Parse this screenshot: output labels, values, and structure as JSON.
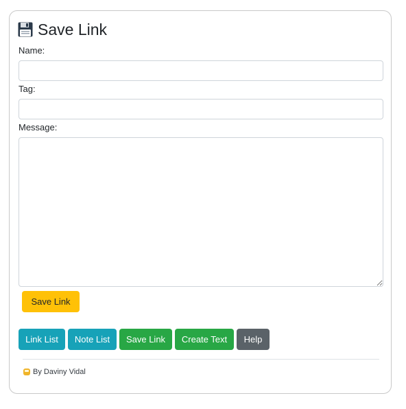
{
  "header": {
    "title": "Save Link",
    "icon": "floppy-disk-icon"
  },
  "form": {
    "name_label": "Name:",
    "name_value": "",
    "tag_label": "Tag:",
    "tag_value": "",
    "message_label": "Message:",
    "message_value": "",
    "submit_label": "Save Link"
  },
  "nav": {
    "link_list": "Link List",
    "note_list": "Note List",
    "save_link": "Save Link",
    "create_text": "Create Text",
    "help": "Help"
  },
  "footer": {
    "icon": "emoji-icon",
    "credit": "By Daviny Vidal"
  },
  "colors": {
    "warning": "#ffc107",
    "info": "#17a2b8",
    "success": "#28a745",
    "secondary": "#5a6268"
  }
}
